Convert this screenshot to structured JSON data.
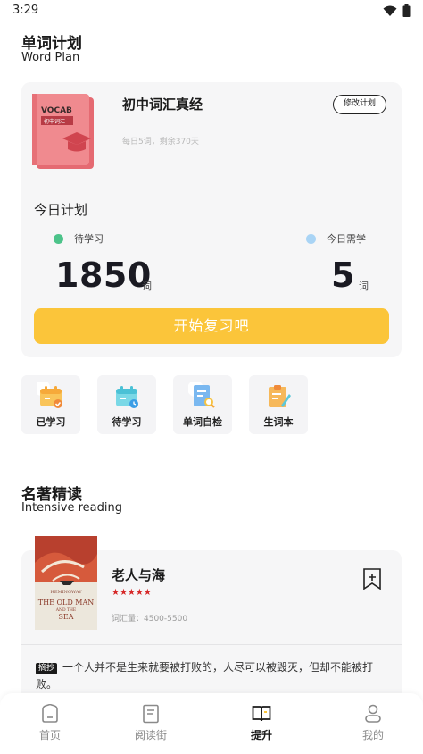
{
  "status_bar": {
    "time": "3:29"
  },
  "word_plan": {
    "title": "单词计划",
    "subtitle": "Word Plan",
    "book": {
      "cover_top": "VOCAB",
      "cover_tag": "初中词汇",
      "title": "初中词汇真经",
      "meta": "每日5词，剩余370天"
    },
    "modify_label": "修改计划",
    "today_title": "今日计划",
    "pending": {
      "label": "待学习",
      "value": "1850",
      "unit": "词",
      "color": "#4cc38a"
    },
    "needed": {
      "label": "今日需学",
      "value": "5",
      "unit": "词",
      "color": "#a9d4f5"
    },
    "start_label": "开始复习吧",
    "accent": "#fbc53a"
  },
  "tools": [
    {
      "label": "已学习",
      "icon": "calendar-check-icon"
    },
    {
      "label": "待学习",
      "icon": "calendar-clock-icon"
    },
    {
      "label": "单词自检",
      "icon": "document-search-icon"
    },
    {
      "label": "生词本",
      "icon": "notebook-pen-icon"
    }
  ],
  "reading": {
    "title": "名著精读",
    "subtitle": "Intensive reading",
    "book": {
      "cover_author": "HEMINGWAY",
      "cover_title_1": "THE OLD MAN",
      "cover_title_2": "AND THE",
      "cover_title_3": "SEA",
      "title": "老人与海",
      "stars": "★★★★★",
      "vocab": "词汇量：4500-5500"
    },
    "excerpt_tag": "摘抄",
    "excerpt": "一个人并不是生来就要被打败的，人尽可以被毁灭，但却不能被打败。"
  },
  "tabs": [
    {
      "label": "首页",
      "icon": "home-icon",
      "active": false
    },
    {
      "label": "阅读街",
      "icon": "book-icon",
      "active": false
    },
    {
      "label": "提升",
      "icon": "open-book-icon",
      "active": true
    },
    {
      "label": "我的",
      "icon": "user-icon",
      "active": false
    }
  ]
}
